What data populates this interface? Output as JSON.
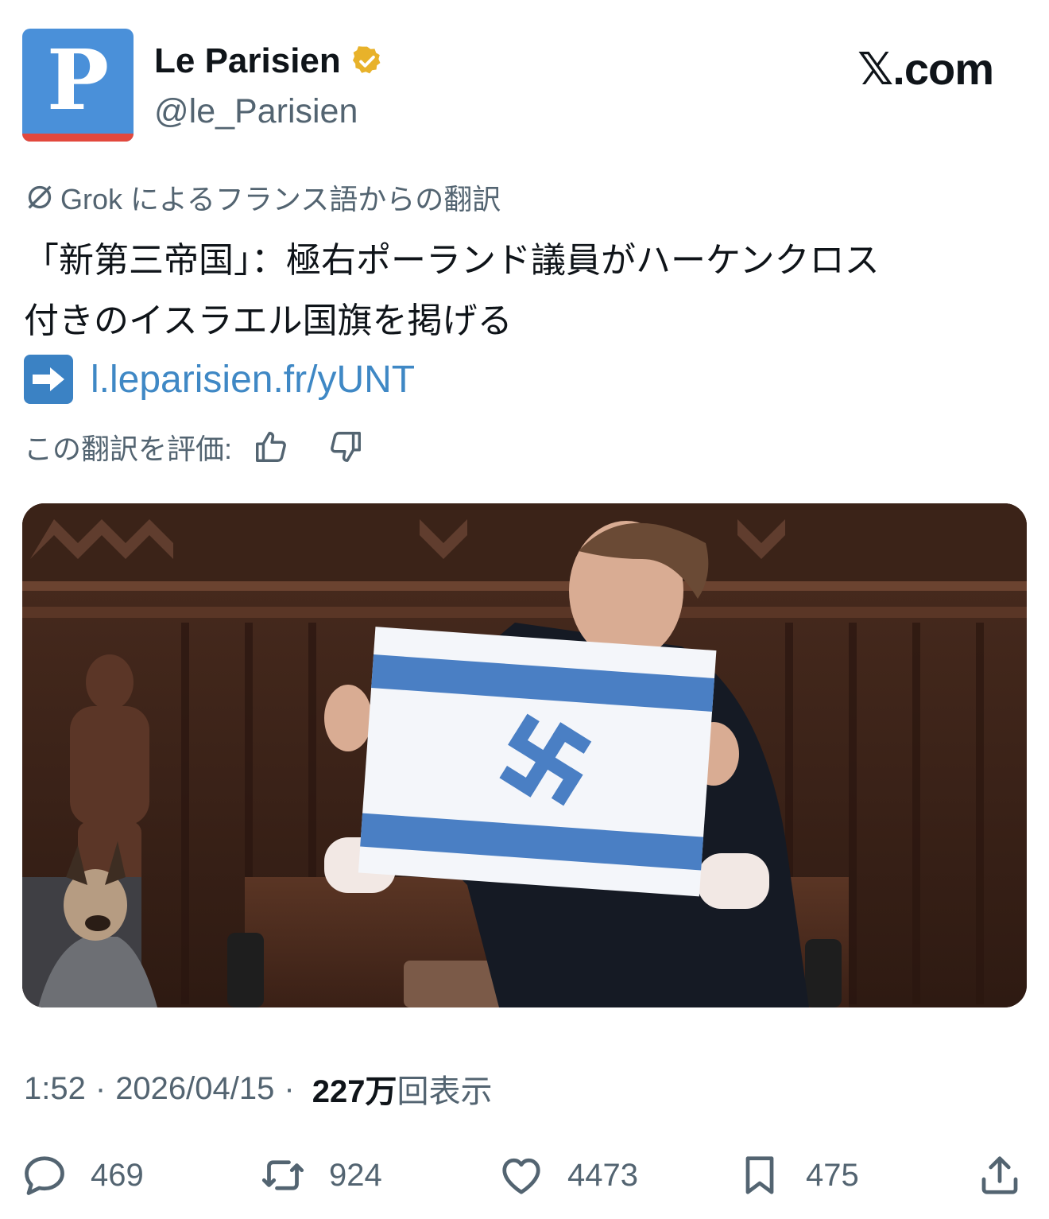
{
  "account": {
    "avatar_letter": "P",
    "name": "Le Parisien",
    "handle": "@le_Parisien",
    "verified_icon": "verified-badge-icon",
    "brand_colors": {
      "avatar_bg": "#4a90d9",
      "avatar_stripe": "#e2483d",
      "verified": "#e8b22a"
    }
  },
  "site_label": "𝕏.com",
  "translation": {
    "label": "Grok によるフランス語からの翻訳",
    "icon": "grok-icon"
  },
  "tweet": {
    "text_line1": "「新第三帝国」：極右ポーランド議員がハーケンクロス",
    "text_line2": "付きのイスラエル国旗を掲げる",
    "link_icon": "arrow-right-emoji-icon",
    "link": "l.leparisien.fr/yUNT",
    "link_color": "#3f88c5"
  },
  "rate": {
    "label": "この翻訳を評価:",
    "up_icon": "thumbs-up-icon",
    "down_icon": "thumbs-down-icon"
  },
  "media": {
    "kind": "photo",
    "icon": "media-photo"
  },
  "meta": {
    "time": "1:52",
    "separator": "·",
    "date": "2026/04/15",
    "views": "227万",
    "views_label": "回表示"
  },
  "actions": {
    "reply_count": "469",
    "retweet_count": "924",
    "like_count": "4473",
    "bookmark_count": "475"
  }
}
